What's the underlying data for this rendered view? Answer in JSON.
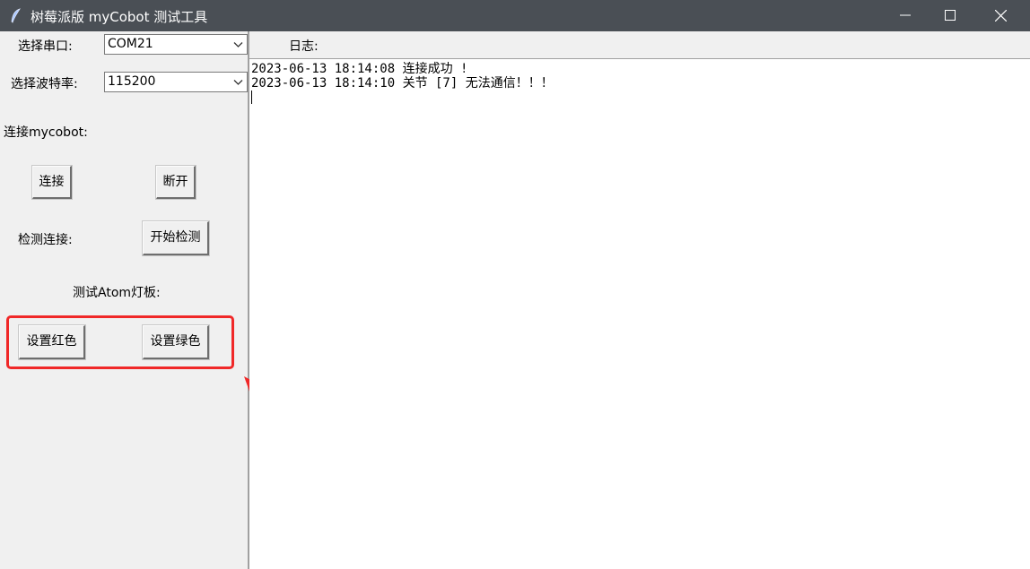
{
  "window": {
    "title": "树莓派版 myCobot 测试工具",
    "icons": [
      "feather-app-icon",
      "minimize-icon",
      "maximize-icon",
      "close-icon"
    ]
  },
  "serial": {
    "port_label": "选择串口:",
    "port_value": "COM21",
    "baud_label": "选择波特率:",
    "baud_value": "115200"
  },
  "connect": {
    "section_label": "连接mycobot:",
    "connect_button": "连接",
    "disconnect_button": "断开"
  },
  "check": {
    "label": "检测连接:",
    "start_button": "开始检测"
  },
  "atom": {
    "section_label": "测试Atom灯板:",
    "red_button": "设置红色",
    "green_button": "设置绿色"
  },
  "log": {
    "header": "日志:",
    "lines": [
      "2023-06-13 18:14:08 连接成功 !",
      "2023-06-13 18:14:10 关节 [7] 无法通信！！！"
    ]
  },
  "colors": {
    "titlebar": "#4a4f55",
    "panel": "#f0f0f0",
    "annotation_red": "#f02828"
  }
}
